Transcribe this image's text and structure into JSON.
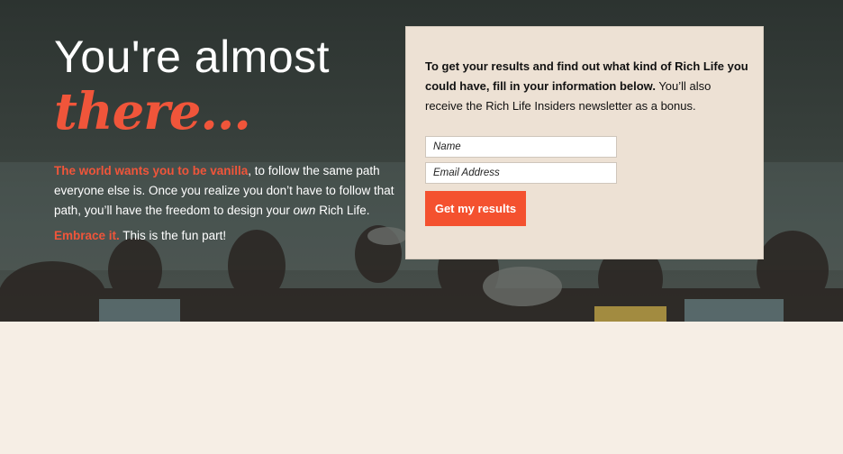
{
  "hero": {
    "headline_line1": "You're almost",
    "headline_line2": "there...",
    "intro_accent": "The world wants you to be vanilla",
    "intro_text_a": ", to follow the same path everyone else is. Once you realize you don’t have to follow that path, you’ll have the freedom to design your ",
    "intro_emphasis": "own",
    "intro_text_b": " Rich Life.",
    "embrace_accent": "Embrace it.",
    "embrace_text": " This is the fun part!"
  },
  "form": {
    "desc_bold": "To get your results and find out what kind of Rich Life you could have, fill in your information below.",
    "desc_regular": " You’ll also receive the Rich Life Insiders newsletter as a bonus.",
    "name_placeholder": "Name",
    "email_placeholder": "Email Address",
    "submit_label": "Get my results"
  },
  "colors": {
    "accent": "#f0553a",
    "button": "#f4512f",
    "card_bg": "#ede1d4",
    "page_bg": "#f6eee5"
  }
}
